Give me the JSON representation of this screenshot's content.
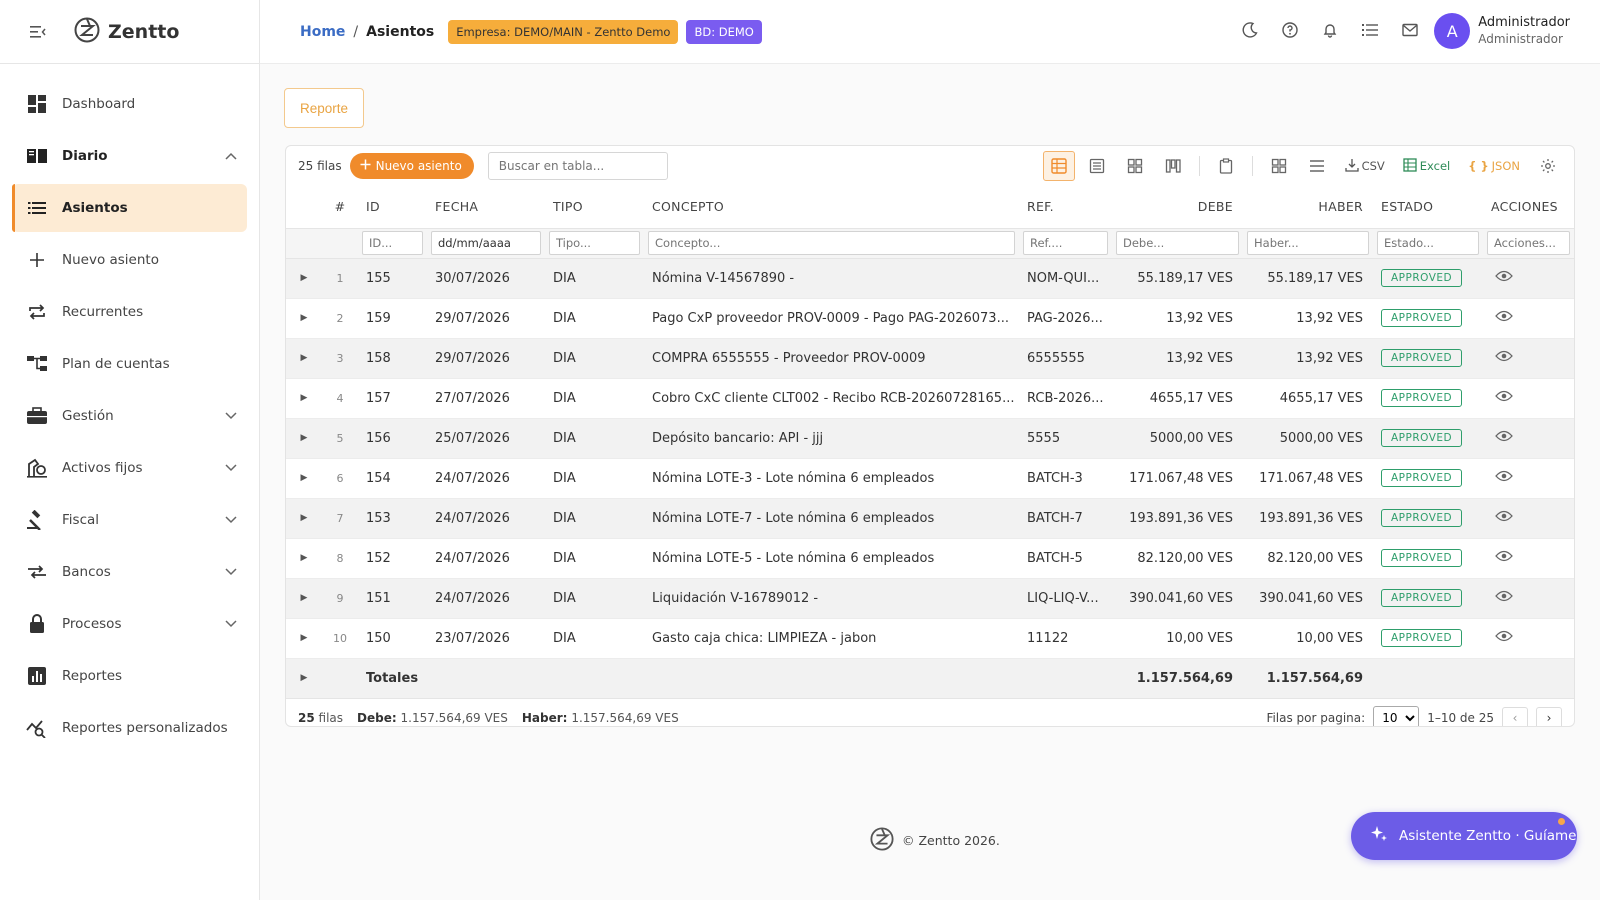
{
  "app": {
    "name": "Zentto"
  },
  "sidebar": {
    "items": [
      {
        "label": "Dashboard",
        "icon": "dashboard-icon"
      },
      {
        "label": "Diario",
        "icon": "book-icon",
        "expanded": true
      },
      {
        "label": "Asientos",
        "icon": "list-icon",
        "active": true
      },
      {
        "label": "Nuevo asiento",
        "icon": "plus-icon"
      },
      {
        "label": "Recurrentes",
        "icon": "repeat-icon"
      },
      {
        "label": "Plan de cuentas",
        "icon": "tree-icon"
      },
      {
        "label": "Gestión",
        "icon": "briefcase-icon"
      },
      {
        "label": "Activos fijos",
        "icon": "asset-icon"
      },
      {
        "label": "Fiscal",
        "icon": "gavel-icon"
      },
      {
        "label": "Bancos",
        "icon": "transfer-icon"
      },
      {
        "label": "Procesos",
        "icon": "lock-icon"
      },
      {
        "label": "Reportes",
        "icon": "bar-chart-icon"
      },
      {
        "label": "Reportes personalizados",
        "icon": "analytics-icon"
      }
    ]
  },
  "header": {
    "breadcrumb": {
      "home": "Home",
      "separator": "/",
      "current": "Asientos"
    },
    "empresa_badge": "Empresa: DEMO/MAIN - Zentto Demo",
    "bd_badge": "BD: DEMO",
    "user": {
      "initial": "A",
      "name": "Administrador",
      "role": "Administrador"
    }
  },
  "main": {
    "report_button": "Reporte",
    "toolbar": {
      "rows_count": "25 filas",
      "new_button": "Nuevo asiento",
      "search_placeholder": "Buscar en tabla...",
      "csv": "CSV",
      "excel": "Excel",
      "json": "JSON"
    },
    "columns": [
      "#",
      "ID",
      "FECHA",
      "TIPO",
      "CONCEPTO",
      "REF.",
      "DEBE",
      "HABER",
      "ESTADO",
      "ACCIONES"
    ],
    "filters": {
      "id": "ID...",
      "fecha": "dd/mm/aaaa",
      "tipo": "Tipo...",
      "concepto": "Concepto...",
      "ref": "Ref....",
      "debe": "Debe...",
      "haber": "Haber...",
      "estado": "Estado...",
      "acciones": "Acciones..."
    },
    "rows": [
      {
        "n": "1",
        "id": "155",
        "fecha": "30/07/2026",
        "tipo": "DIA",
        "concepto": "Nómina V-14567890 -",
        "ref": "NOM-QUI...",
        "debe": "55.189,17 VES",
        "haber": "55.189,17 VES",
        "estado": "APPROVED"
      },
      {
        "n": "2",
        "id": "159",
        "fecha": "29/07/2026",
        "tipo": "DIA",
        "concepto": "Pago CxP proveedor PROV-0009 - Pago PAG-2026073...",
        "ref": "PAG-2026...",
        "debe": "13,92 VES",
        "haber": "13,92 VES",
        "estado": "APPROVED"
      },
      {
        "n": "3",
        "id": "158",
        "fecha": "29/07/2026",
        "tipo": "DIA",
        "concepto": "COMPRA 6555555 - Proveedor PROV-0009",
        "ref": "6555555",
        "debe": "13,92 VES",
        "haber": "13,92 VES",
        "estado": "APPROVED"
      },
      {
        "n": "4",
        "id": "157",
        "fecha": "27/07/2026",
        "tipo": "DIA",
        "concepto": "Cobro CxC cliente CLT002 - Recibo RCB-20260728165...",
        "ref": "RCB-2026...",
        "debe": "4655,17 VES",
        "haber": "4655,17 VES",
        "estado": "APPROVED"
      },
      {
        "n": "5",
        "id": "156",
        "fecha": "25/07/2026",
        "tipo": "DIA",
        "concepto": "Depósito bancario: API - jjj",
        "ref": "5555",
        "debe": "5000,00 VES",
        "haber": "5000,00 VES",
        "estado": "APPROVED"
      },
      {
        "n": "6",
        "id": "154",
        "fecha": "24/07/2026",
        "tipo": "DIA",
        "concepto": "Nómina LOTE-3 - Lote nómina 6 empleados",
        "ref": "BATCH-3",
        "debe": "171.067,48 VES",
        "haber": "171.067,48 VES",
        "estado": "APPROVED"
      },
      {
        "n": "7",
        "id": "153",
        "fecha": "24/07/2026",
        "tipo": "DIA",
        "concepto": "Nómina LOTE-7 - Lote nómina 6 empleados",
        "ref": "BATCH-7",
        "debe": "193.891,36 VES",
        "haber": "193.891,36 VES",
        "estado": "APPROVED"
      },
      {
        "n": "8",
        "id": "152",
        "fecha": "24/07/2026",
        "tipo": "DIA",
        "concepto": "Nómina LOTE-5 - Lote nómina 6 empleados",
        "ref": "BATCH-5",
        "debe": "82.120,00 VES",
        "haber": "82.120,00 VES",
        "estado": "APPROVED"
      },
      {
        "n": "9",
        "id": "151",
        "fecha": "24/07/2026",
        "tipo": "DIA",
        "concepto": "Liquidación V-16789012 -",
        "ref": "LIQ-LIQ-V...",
        "debe": "390.041,60 VES",
        "haber": "390.041,60 VES",
        "estado": "APPROVED"
      },
      {
        "n": "10",
        "id": "150",
        "fecha": "23/07/2026",
        "tipo": "DIA",
        "concepto": "Gasto caja chica: LIMPIEZA - jabon",
        "ref": "11122",
        "debe": "10,00 VES",
        "haber": "10,00 VES",
        "estado": "APPROVED"
      }
    ],
    "totals": {
      "label": "Totales",
      "debe": "1.157.564,69",
      "haber": "1.157.564,69"
    },
    "footer": {
      "rows": "25",
      "rows_label": "filas",
      "debe_label": "Debe:",
      "debe_value": "1.157.564,69 VES",
      "haber_label": "Haber:",
      "haber_value": "1.157.564,69 VES",
      "per_page_label": "Filas por pagina:",
      "per_page_value": "10",
      "range": "1–10 de 25"
    }
  },
  "copyright": "© Zentto 2026.",
  "assistant": {
    "label": "Asistente Zentto · Guíame"
  },
  "colors": {
    "accent": "#f08b2b",
    "purple": "#6c5ce7",
    "approved": "#2e9e6b",
    "link": "#3b6cc4"
  }
}
